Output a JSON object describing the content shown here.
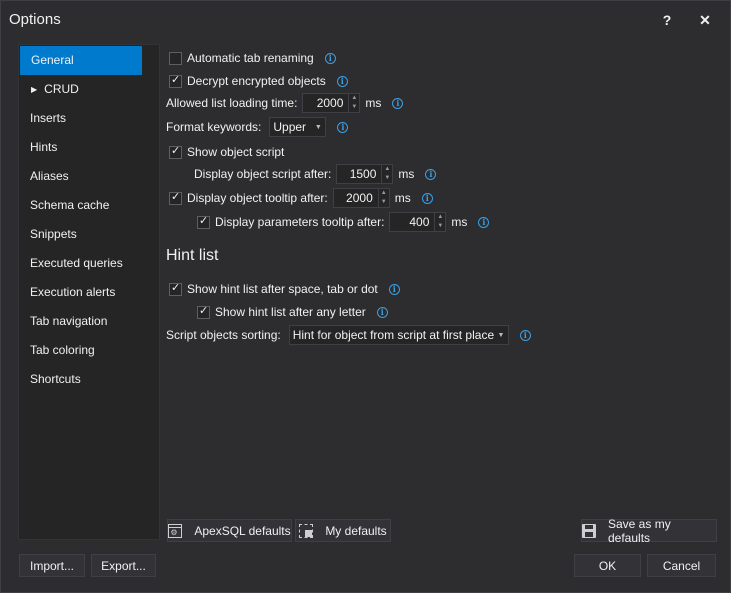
{
  "window": {
    "title": "Options",
    "help_glyph": "?",
    "close_glyph": "✕"
  },
  "sidebar": {
    "items": [
      {
        "label": "General",
        "active": true
      },
      {
        "label": "CRUD",
        "expandable": true
      },
      {
        "label": "Inserts"
      },
      {
        "label": "Hints"
      },
      {
        "label": "Aliases"
      },
      {
        "label": "Schema cache"
      },
      {
        "label": "Snippets"
      },
      {
        "label": "Executed queries"
      },
      {
        "label": "Execution alerts"
      },
      {
        "label": "Tab navigation"
      },
      {
        "label": "Tab coloring"
      },
      {
        "label": "Shortcuts"
      }
    ]
  },
  "general": {
    "auto_tab_renaming": {
      "label": "Automatic tab renaming",
      "checked": false
    },
    "decrypt_objects": {
      "label": "Decrypt encrypted objects",
      "checked": true
    },
    "list_loading_time": {
      "label": "Allowed list loading time:",
      "value": "2000",
      "unit": "ms"
    },
    "format_keywords": {
      "label": "Format keywords:",
      "value": "Upper"
    },
    "show_object_script": {
      "label": "Show object script",
      "checked": true
    },
    "display_script_after": {
      "label": "Display object script after:",
      "value": "1500",
      "unit": "ms"
    },
    "display_tooltip_after": {
      "label": "Display object tooltip after:",
      "checked": true,
      "value": "2000",
      "unit": "ms"
    },
    "display_params_tooltip": {
      "label": "Display parameters tooltip after:",
      "checked": true,
      "value": "400",
      "unit": "ms"
    }
  },
  "hint_list": {
    "title": "Hint list",
    "after_space": {
      "label": "Show hint list after space, tab or dot",
      "checked": true
    },
    "after_letter": {
      "label": "Show hint list after any letter",
      "checked": true
    },
    "sorting": {
      "label": "Script objects sorting:",
      "value": "Hint for object from script at first place"
    }
  },
  "info_glyph": "i",
  "spin_up": "▲",
  "spin_down": "▼",
  "combo_arrow": "▼",
  "expand_arrow": "▶",
  "footer": {
    "apexsql_defaults": "ApexSQL defaults",
    "my_defaults": "My defaults",
    "save_defaults": "Save as my defaults",
    "import": "Import...",
    "export": "Export...",
    "ok": "OK",
    "cancel": "Cancel"
  },
  "colors": {
    "accent": "#007acc",
    "background": "#2d2d30",
    "panel": "#252526",
    "info": "#3c9fe3"
  }
}
